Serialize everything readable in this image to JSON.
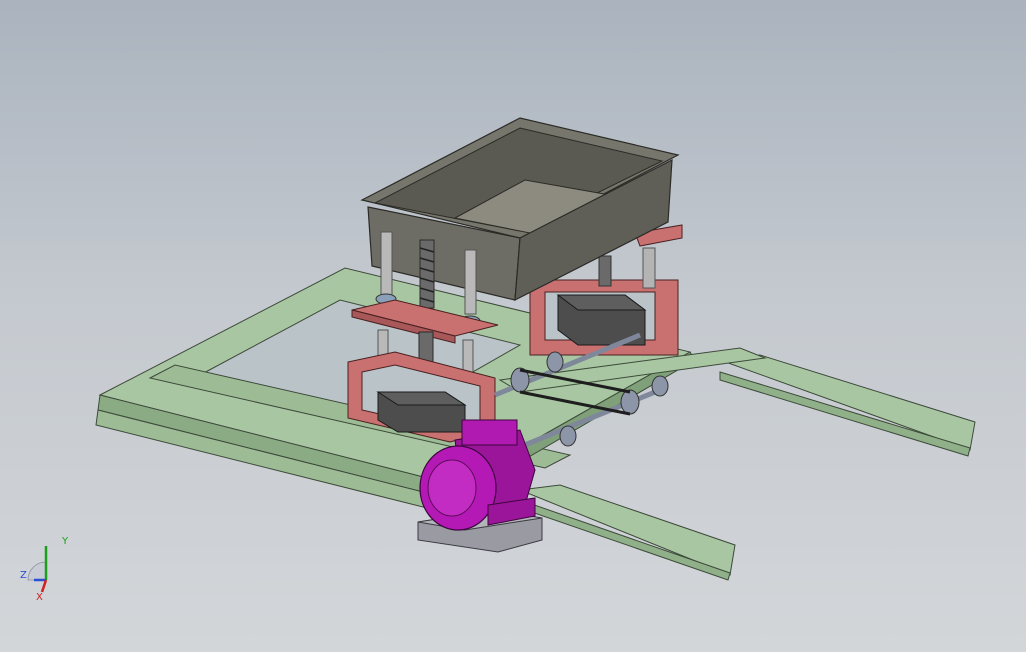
{
  "viewport": {
    "title": "",
    "background_top": "#aab3be",
    "background_bottom": "#d3d6d9"
  },
  "model": {
    "parts": [
      {
        "name": "frame",
        "color": "#a7c4a0"
      },
      {
        "name": "hopper",
        "color": "#6b6a62"
      },
      {
        "name": "spring-support-plates",
        "color": "#c97575"
      },
      {
        "name": "vibration-motor-boxes",
        "color": "#4a4a4a"
      },
      {
        "name": "drive-motor",
        "color": "#b519b5"
      },
      {
        "name": "motor-base",
        "color": "#9a9aa0"
      },
      {
        "name": "belt-drive",
        "color": "#222222"
      },
      {
        "name": "shafts",
        "color": "#8c96a8"
      }
    ]
  },
  "triad": {
    "x_label": "X",
    "y_label": "Y",
    "z_label": "Z",
    "x_color": "#d22020",
    "y_color": "#1aa01a",
    "z_color": "#2a4fd6"
  }
}
